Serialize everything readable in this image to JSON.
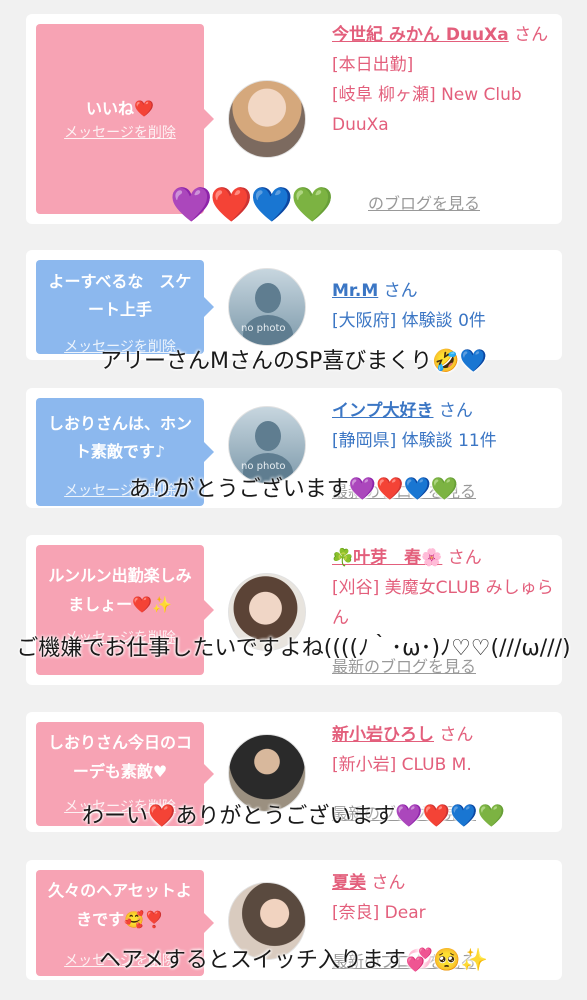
{
  "entries": [
    {
      "bubble_text": "いいね❤️",
      "delete_label": "メッセージを削除",
      "name": "今世紀 みかん DuuXa",
      "san": "さん[本日出勤]",
      "meta": "[岐阜 柳ヶ瀬] New Club DuuXa",
      "blog": "のブログを見る"
    },
    {
      "bubble_text": "よーすべるな　スケート上手",
      "delete_label": "メッセージを削除",
      "name": "Mr.M",
      "san": "さん",
      "meta": "[大阪府] 体験談 0件",
      "nophoto": "no photo"
    },
    {
      "bubble_text": "しおりさんは、ホント素敵です♪",
      "delete_label": "メッセージを削除",
      "name": "インプ大好き",
      "san": "さん",
      "meta": "[静岡県] 体験談 11件",
      "nophoto": "no photo",
      "blog": "最新のブログを見る"
    },
    {
      "bubble_text": "ルンルン出勤楽しみましょー❤️✨",
      "delete_label": "メッセージを削除",
      "name": "☘️叶芽　春🌸",
      "san": "さん",
      "meta": "[刈谷] 美魔女CLUB みしゅらん",
      "blog": "最新のブログを見る"
    },
    {
      "bubble_text": "しおりさん今日のコーデも素敵♥",
      "delete_label": "メッセージを削除",
      "name": "新小岩ひろし",
      "san": "さん",
      "meta": "[新小岩] CLUB M.",
      "blog": "最新のブログを見る"
    },
    {
      "bubble_text": "久々のヘアセットよきです🥰❣️",
      "delete_label": "メッセージを削除",
      "name": "夏美",
      "san": "さん",
      "meta": "[奈良] Dear",
      "blog": "最新のブログを見る"
    }
  ],
  "overlays": {
    "hearts_1": "💜❤️💙💚",
    "caption_1": "アリーさんMさんのSP喜びまくり🤣💙",
    "caption_2": "ありがとうございます💜❤️💙💚",
    "caption_3": "ご機嫌でお仕事したいですよね((((ﾉ｀･ω･)ﾉ♡♡(///ω///)",
    "caption_4": "わーい❤️ありがとうございます💜❤️💙💚",
    "caption_5": "ヘアメするとスイッチ入ります💞🥺✨"
  }
}
